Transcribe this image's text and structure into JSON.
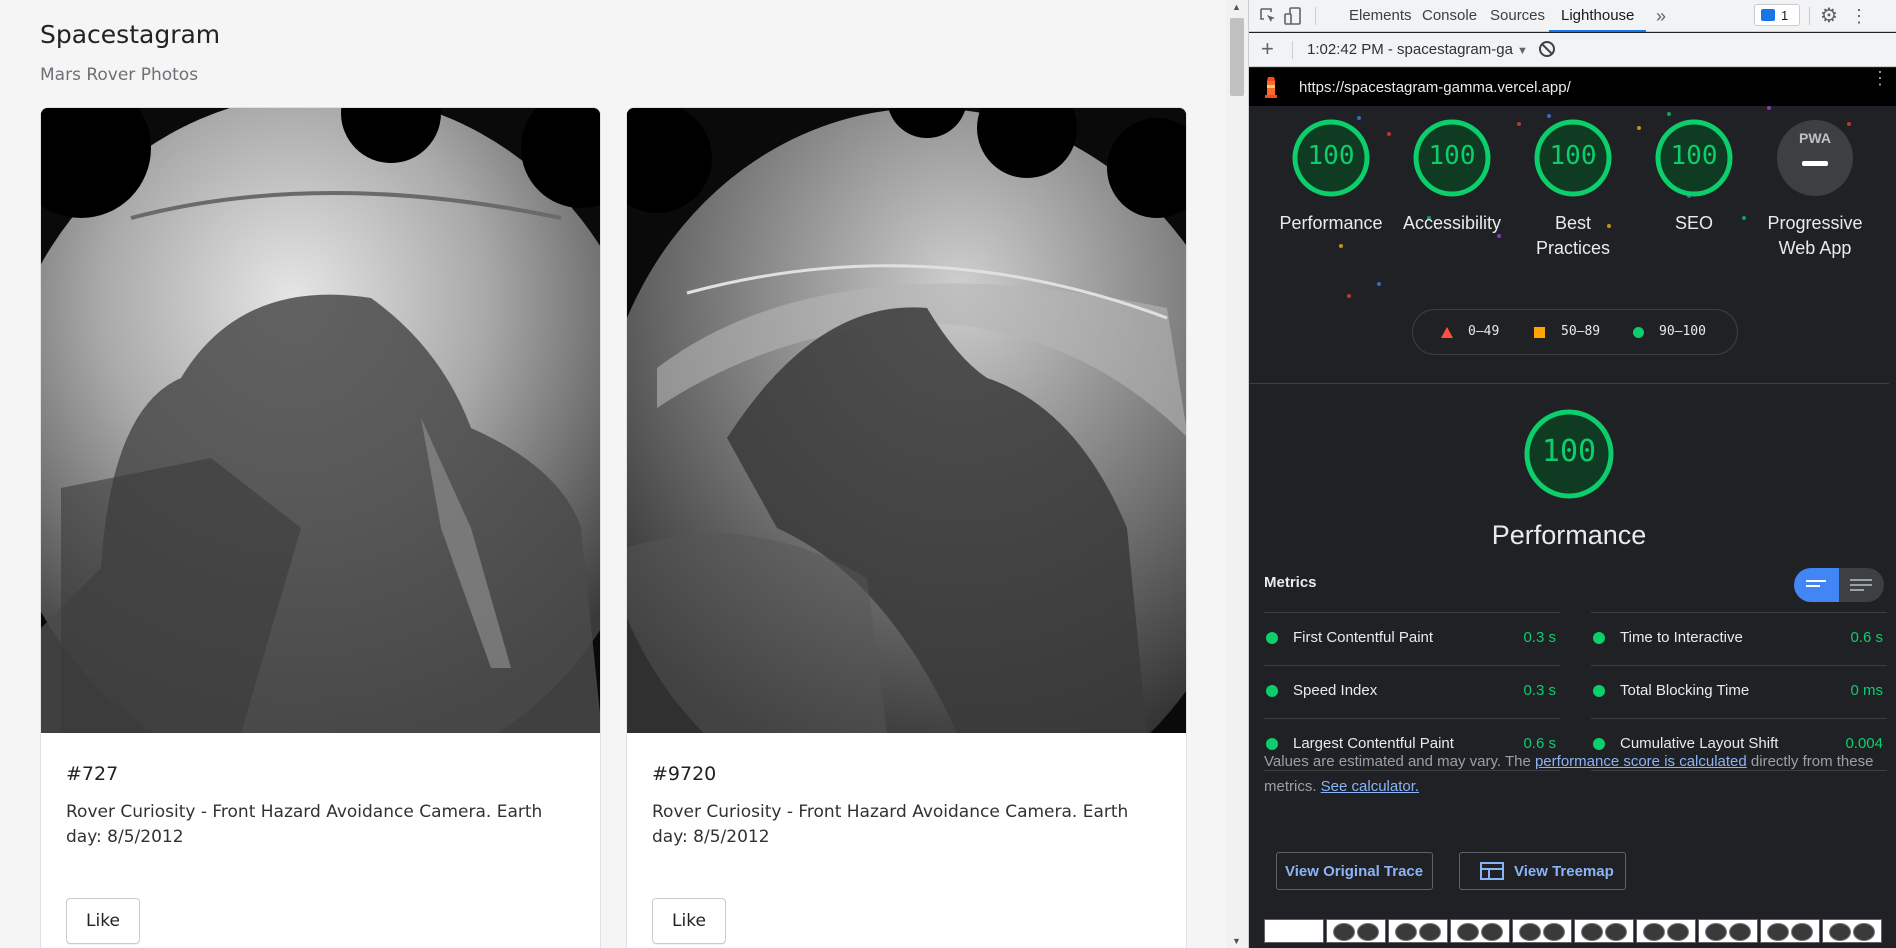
{
  "app": {
    "title": "Spacestagram",
    "subtitle": "Mars Rover Photos",
    "cards": [
      {
        "id": "#727",
        "description": "Rover Curiosity - Front Hazard Avoidance Camera. Earth day: 8/5/2012",
        "like_label": "Like"
      },
      {
        "id": "#9720",
        "description": "Rover Curiosity - Front Hazard Avoidance Camera. Earth day: 8/5/2012",
        "like_label": "Like"
      }
    ]
  },
  "devtools": {
    "tabs": [
      "Elements",
      "Console",
      "Sources",
      "Lighthouse"
    ],
    "active_tab": "Lighthouse",
    "issues_count": "1",
    "report_selector": "1:02:42 PM - spacestagram-ga",
    "report_url": "https://spacestagram-gamma.vercel.app/",
    "category_gauges": [
      {
        "score": "100",
        "label": "Performance"
      },
      {
        "score": "100",
        "label": "Accessibility"
      },
      {
        "score": "100",
        "label": "Best Practices"
      },
      {
        "score": "100",
        "label": "SEO"
      },
      {
        "label": "Progressive Web App",
        "badge": "PWA"
      }
    ],
    "legend": {
      "fail": "0–49",
      "average": "50–89",
      "pass": "90–100"
    },
    "performance": {
      "score": "100",
      "title": "Performance"
    },
    "metrics_title": "Metrics",
    "metrics": [
      {
        "name": "First Contentful Paint",
        "value": "0.3 s"
      },
      {
        "name": "Time to Interactive",
        "value": "0.6 s"
      },
      {
        "name": "Speed Index",
        "value": "0.3 s"
      },
      {
        "name": "Total Blocking Time",
        "value": "0 ms"
      },
      {
        "name": "Largest Contentful Paint",
        "value": "0.6 s"
      },
      {
        "name": "Cumulative Layout Shift",
        "value": "0.004"
      }
    ],
    "note": {
      "before": "Values are estimated and may vary. The ",
      "link1": "performance score is calculated",
      "middle": " directly from these metrics. ",
      "link2": "See calculator."
    },
    "buttons": {
      "view_trace": "View Original Trace",
      "view_treemap": "View Treemap"
    },
    "colors": {
      "pass": "#0cce6b",
      "average": "#ffa400",
      "fail": "#ff4e42",
      "accent": "#1a73e8"
    }
  }
}
